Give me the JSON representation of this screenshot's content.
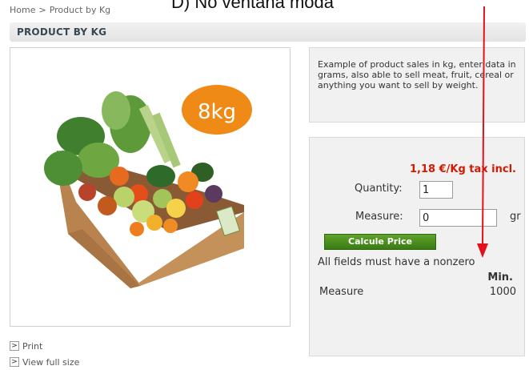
{
  "annotation": {
    "text": "D) No ventana moda"
  },
  "breadcrumb": {
    "home": "Home",
    "separator": ">",
    "current": "Product by Kg"
  },
  "page_title": "PRODUCT BY KG",
  "product_image": {
    "badge_text": "8kg"
  },
  "links": {
    "print": "Print",
    "view_full_size": "View full size",
    "arrow": ">"
  },
  "description": "Example of product sales in kg, enter data in grams, also able to sell meat, fruit, cereal or anything you want to sell by weight.",
  "pricing": {
    "price": "1,18 €/Kg tax incl.",
    "quantity_label": "Quantity:",
    "quantity_value": "1",
    "measure_label": "Measure:",
    "measure_value": "0",
    "measure_unit": "gr",
    "calc_button": "Calcule Price",
    "warning": "All fields must have a nonzero",
    "min_header": "Min.",
    "min_row_label": "Measure",
    "min_row_value": "1000"
  },
  "colors": {
    "price_red": "#d11a00",
    "button_green": "#4c8e1f",
    "arrow_red": "#e3121a",
    "panel_gray": "#f1f1f1"
  }
}
